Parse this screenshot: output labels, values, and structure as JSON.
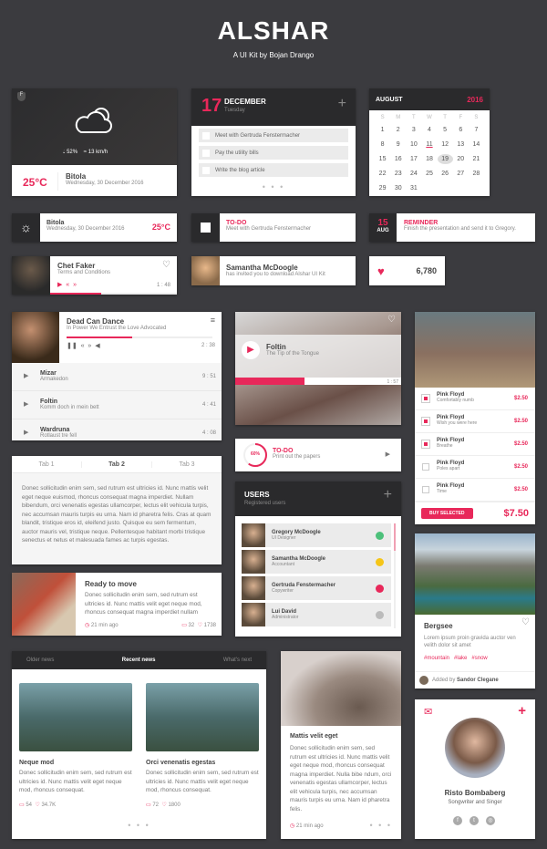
{
  "header": {
    "title": "ALSHAR",
    "subtitle": "A UI Kit by Bojan Drango"
  },
  "colors": {
    "accent": "#e8285a",
    "background": "#3b3b3f",
    "dark": "#2a2a2c"
  },
  "weather_card": {
    "humidity": "52%",
    "wind": "13 km/h",
    "temp": "25°C",
    "city": "Bitola",
    "date": "Wednesday, 30 December 2016",
    "icon": "cloud-sun-icon"
  },
  "todo_card": {
    "day": "17",
    "month": "DECEMBER",
    "weekday": "Tuesday",
    "items": [
      "Meet with Gertruda Fenstermacher",
      "Pay the utility bills",
      "Write the blog article"
    ],
    "more": "• • •"
  },
  "calendar": {
    "month": "AUGUST",
    "year": "2016",
    "weekdays": [
      "S",
      "M",
      "T",
      "W",
      "T",
      "F",
      "S"
    ],
    "weeks": [
      [
        "1",
        "2",
        "3",
        "4",
        "5",
        "6",
        "7"
      ],
      [
        "8",
        "9",
        "10",
        "11",
        "12",
        "13",
        "14"
      ],
      [
        "15",
        "16",
        "17",
        "18",
        "19",
        "20",
        "21"
      ],
      [
        "22",
        "23",
        "24",
        "25",
        "26",
        "27",
        "28"
      ],
      [
        "29",
        "30",
        "31",
        "",
        "",
        "",
        ""
      ]
    ],
    "today": "11",
    "selected": "19"
  },
  "weather_small": {
    "city": "Bitola",
    "date": "Wednesday, 30 December 2016",
    "temp": "25°C"
  },
  "todo_small": {
    "title": "TO-DO",
    "text": "Meet with Gertruda Fenstermacher"
  },
  "reminder": {
    "day": "15",
    "month": "AUG",
    "title": "REMINDER",
    "text": "Finish the presentation and send it to Gregory."
  },
  "mini_player": {
    "artist": "Chet Faker",
    "track": "Terms and Conditions",
    "time": "1 : 48",
    "progress": 0.4
  },
  "invite": {
    "name": "Samantha McDoogle",
    "text": "has invited you to download Alshar UI Kit"
  },
  "likes": {
    "count": "6,780"
  },
  "player": {
    "artist": "Dead Can Dance",
    "track": "In Power We Entrust the Love Advocated",
    "time": "2 : 38",
    "progress": 0.45,
    "playlist": [
      {
        "artist": "Mizar",
        "track": "Armakedon",
        "time": "9 : 51"
      },
      {
        "artist": "Foltin",
        "track": "Komm doch in mein bett",
        "time": "4 : 41"
      },
      {
        "artist": "Wardruna",
        "track": "Rotlaust tre fell",
        "time": "4 : 08"
      }
    ]
  },
  "foltin": {
    "artist": "Foltin",
    "track": "The Tip of the Tongue",
    "time": "1 : 57",
    "progress": 0.42
  },
  "shop": {
    "items": [
      {
        "artist": "Pink Floyd",
        "track": "Comfortably numb",
        "price": "$2.50",
        "checked": true
      },
      {
        "artist": "Pink Floyd",
        "track": "Wish you were here",
        "price": "$2.50",
        "checked": true
      },
      {
        "artist": "Pink Floyd",
        "track": "Breathe",
        "price": "$2.50",
        "checked": true
      },
      {
        "artist": "Pink Floyd",
        "track": "Poles apart",
        "price": "$2.50",
        "checked": false
      },
      {
        "artist": "Pink Floyd",
        "track": "Time",
        "price": "$2.50",
        "checked": false
      }
    ],
    "buy_label": "BUY SELECTED",
    "total": "$7.50"
  },
  "tabs": {
    "labels": [
      "Tab 1",
      "Tab 2",
      "Tab 3"
    ],
    "active": 1,
    "content": "Donec sollicitudin enim sem, sed rutrum est ultricies id. Nunc mattis velit eget neque euismod, rhoncus consequat magna imperdiet. Nullam bibendum, orci venenatis egestas ullamcorper, lectus elit vehicula turpis, nec accumsan mauris turpis eu urna. Nam id pharetra felis. Cras at quam blandit, tristique eros id, eleifend justo. Quisque eu sem fermentum, auctor mauris vel, tristique neque. Pellentesque habitant morbi tristique senectus et netus et malesuada fames ac turpis egestas."
  },
  "todo_progress": {
    "percent": "60%",
    "value": 0.6,
    "title": "TO-DO",
    "text": "Print out the papers"
  },
  "users": {
    "title": "USERS",
    "subtitle": "Registered users",
    "list": [
      {
        "name": "Gregory McDoogle",
        "role": "UI Designer",
        "status": "#4cc07a"
      },
      {
        "name": "Samantha McDoogle",
        "role": "Accountant",
        "status": "#f5c518"
      },
      {
        "name": "Gertruda Fenstermacher",
        "role": "Copywriter",
        "status": "#e8285a"
      },
      {
        "name": "Lui David",
        "role": "Administrator",
        "status": "#bbbbbb"
      }
    ]
  },
  "ready": {
    "title": "Ready to move",
    "text": "Donec sollicitudin enim sem, sed rutrum est ultricies id. Nunc mattis velit eget neque mod, rhoncus consequat magna imperdiet nullam",
    "time": "21 min ago",
    "comments": "32",
    "likes": "1738"
  },
  "bergsee": {
    "title": "Bergsee",
    "text": "Lorem ipsum proin gravida auctor ven velith dolor sit amet",
    "tags": [
      "#mountain",
      "#lake",
      "#snow"
    ],
    "added_by": "Added by",
    "author": "Sandor Clegane"
  },
  "news": {
    "tabs": [
      "Older news",
      "Recent news",
      "What's next"
    ],
    "items": [
      {
        "title": "Neque mod",
        "text": "Donec sollicitudin enim sem, sed rutrum est ultricies id. Nunc mattis velit eget neque mod, rhoncus consequat.",
        "comments": "54",
        "likes": "34.7K"
      },
      {
        "title": "Orci venenatis egestas",
        "text": "Donec sollicitudin enim sem, sed rutrum est ultricies id. Nunc mattis velit eget neque mod, rhoncus consequat.",
        "comments": "72",
        "likes": "1800"
      }
    ],
    "more": "• • •"
  },
  "mattis": {
    "title": "Mattis velit eget",
    "text": "Donec sollicitudin enim sem, sed rutrum est ultricies id. Nunc mattis velit eget neque mod, rhoncus consequat magna imperdiet. Nulla bibe ndum, orci venenatis egestas ullamcorper, lectus elit vehicula turpis, nec accumsan mauris turpis eu urna. Nam id pharetra felis.",
    "time": "21 min ago",
    "more": "• • •"
  },
  "profile": {
    "name": "Risto Bombaberg",
    "role": "Songwriter and Singer",
    "socials": [
      "facebook-icon",
      "twitter-icon",
      "instagram-icon"
    ]
  }
}
